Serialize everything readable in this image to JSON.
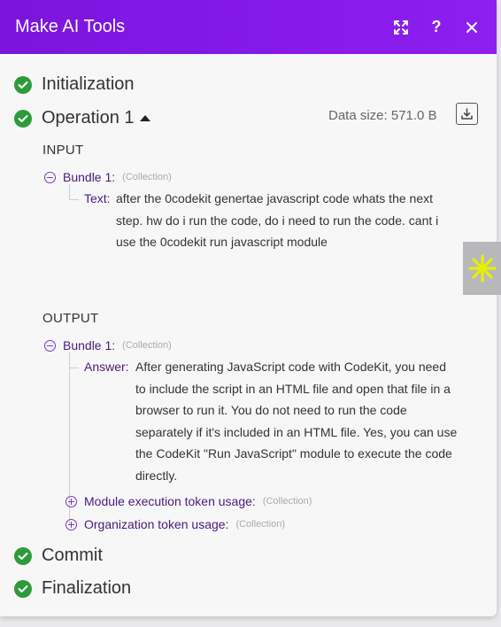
{
  "window": {
    "title": "Make AI Tools"
  },
  "steps": {
    "initialization": "Initialization",
    "operation": "Operation 1",
    "commit": "Commit",
    "finalization": "Finalization"
  },
  "operation": {
    "data_size": "Data size: 571.0 B"
  },
  "input": {
    "heading": "INPUT",
    "bundle_label": "Bundle 1:",
    "bundle_type": "(Collection)",
    "text_key": "Text:",
    "text_lines": [
      "after the 0codekit genertae javascript code whats the next",
      "step. hw do i run the code, do i need to run the code. cant i",
      "use the 0codekit run javascript module"
    ]
  },
  "output": {
    "heading": "OUTPUT",
    "bundle_label": "Bundle 1:",
    "bundle_type": "(Collection)",
    "answer_key": "Answer:",
    "answer_lines": [
      "After generating JavaScript code with CodeKit, you need",
      "to include the script in an HTML file and open that file in a",
      "browser to run it. You do not need to run the code",
      "separately if it's included in an HTML file. Yes, you can use",
      "the CodeKit \"Run JavaScript\" module to execute the code",
      "directly."
    ],
    "module_usage_label": "Module execution token usage:",
    "module_usage_type": "(Collection)",
    "org_usage_label": "Organization token usage:",
    "org_usage_type": "(Collection)"
  },
  "icons": {
    "expand": "expand-icon",
    "help": "help-icon",
    "close": "close-icon",
    "download": "download-icon",
    "status": "check-circle-icon",
    "side": "sparkle-icon"
  },
  "colors": {
    "header": "#7b14dd",
    "success": "#2e9b3b",
    "key": "#4a1a7a",
    "toggle": "#7a38c2",
    "sparkle": "#e6f000"
  }
}
